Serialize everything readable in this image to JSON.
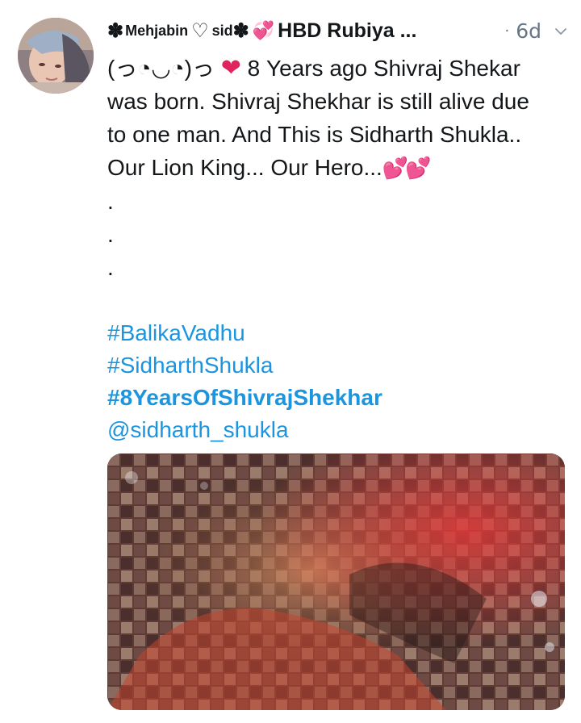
{
  "tweet": {
    "author": {
      "prefix": "Mehjabin",
      "middle": "sid",
      "suffix": "HBD Rubiya ...",
      "avatar_icon": "profile-photo-avatar"
    },
    "time": "6d",
    "time_separator": "·",
    "text": {
      "line1_emoticon": "(っ◔◡◔)っ",
      "line1_rest": "8 Years ago Shivraj Shekar",
      "line2": "was born. Shivraj Shekhar is still alive due",
      "line3": "to one man. And This is Sidharth Shukla..",
      "line4": "Our Lion King... Our Hero...",
      "dots": [
        ".",
        ".",
        "."
      ]
    },
    "hashtags": [
      "#BalikaVadhu",
      "#SidharthShukla",
      "#8YearsOfShivrajShekhar"
    ],
    "mention": "@sidharth_shukla",
    "media_description_icon": "photo-mosaic-image",
    "colors": {
      "link": "#1b95e0",
      "muted": "#657786",
      "heart": "#e0245e"
    }
  }
}
